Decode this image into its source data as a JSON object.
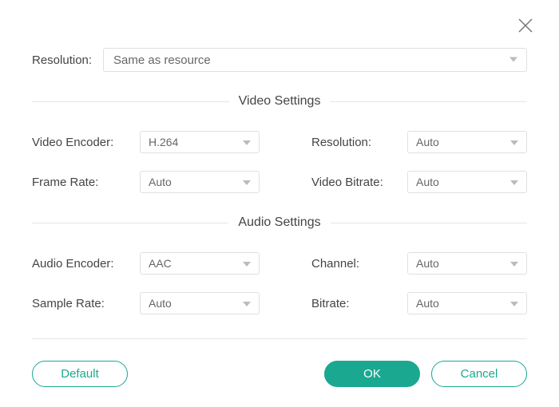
{
  "topResolution": {
    "label": "Resolution:",
    "value": "Same as resource"
  },
  "sections": {
    "video": {
      "title": "Video Settings",
      "encoder": {
        "label": "Video Encoder:",
        "value": "H.264"
      },
      "resolution": {
        "label": "Resolution:",
        "value": "Auto"
      },
      "frameRate": {
        "label": "Frame Rate:",
        "value": "Auto"
      },
      "bitrate": {
        "label": "Video Bitrate:",
        "value": "Auto"
      }
    },
    "audio": {
      "title": "Audio Settings",
      "encoder": {
        "label": "Audio Encoder:",
        "value": "AAC"
      },
      "channel": {
        "label": "Channel:",
        "value": "Auto"
      },
      "sampleRate": {
        "label": "Sample Rate:",
        "value": "Auto"
      },
      "bitrate": {
        "label": "Bitrate:",
        "value": "Auto"
      }
    }
  },
  "buttons": {
    "default": "Default",
    "ok": "OK",
    "cancel": "Cancel"
  },
  "colors": {
    "accent": "#1aa890"
  }
}
